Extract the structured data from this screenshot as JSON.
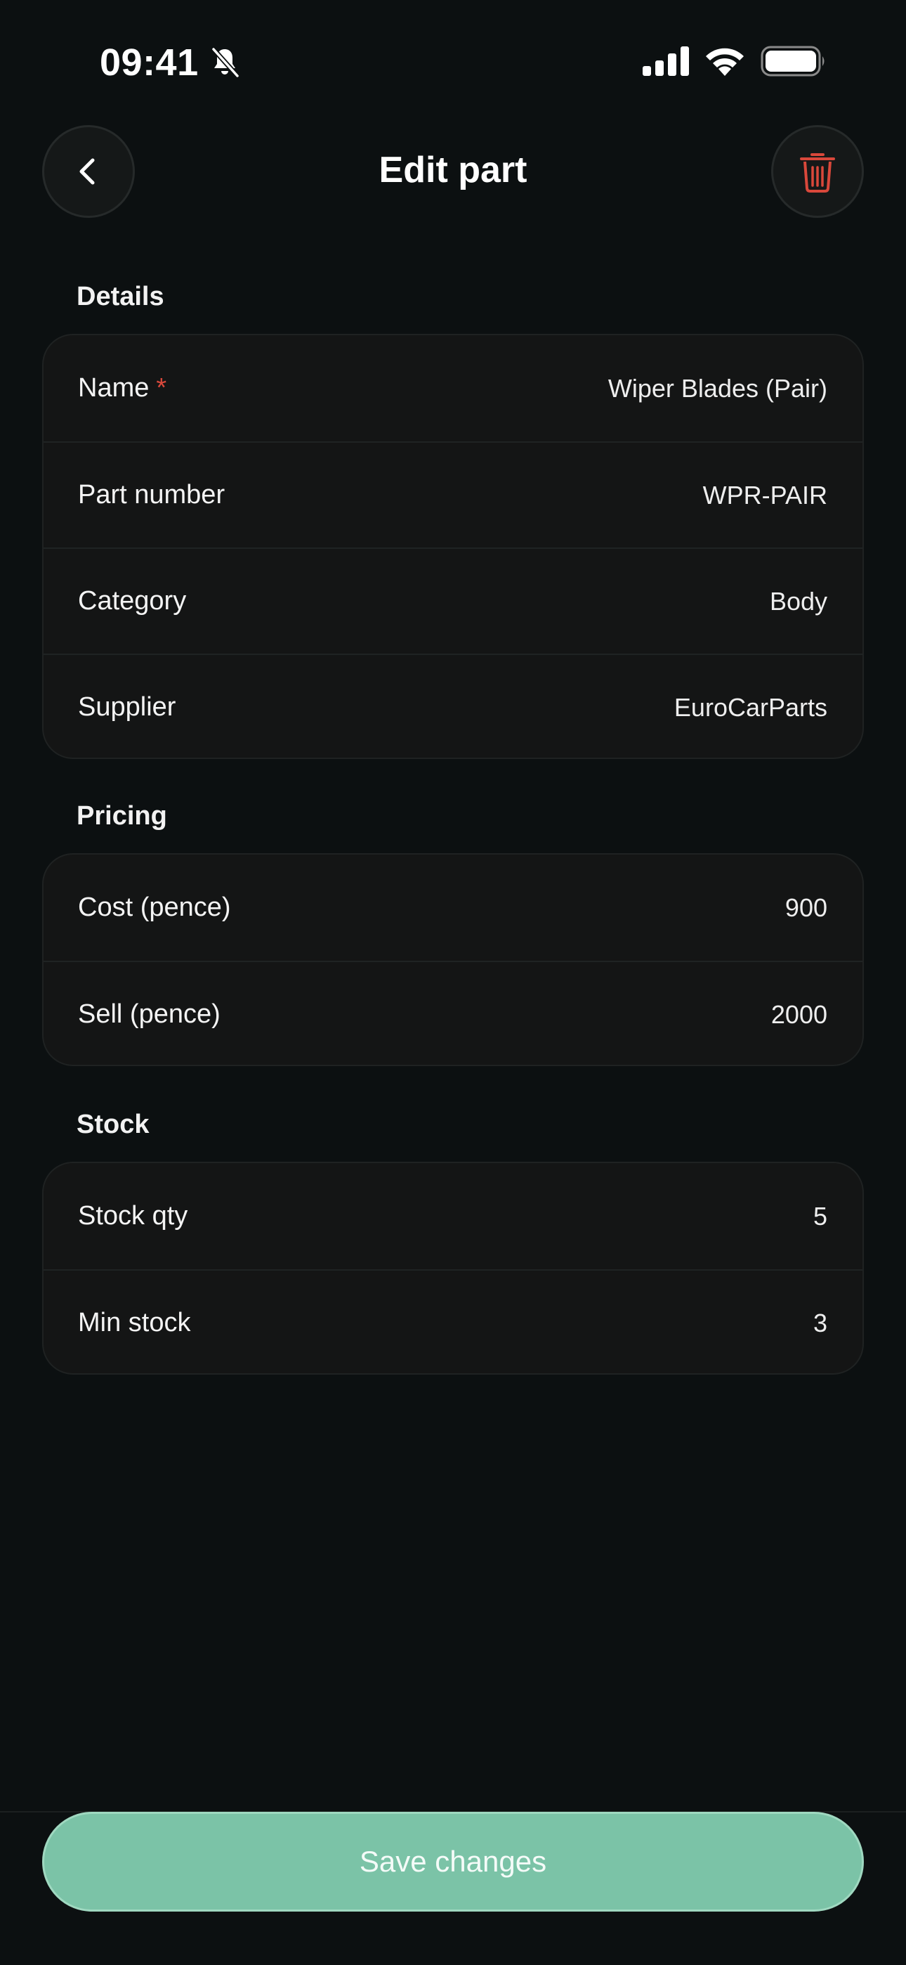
{
  "status_bar": {
    "time": "09:41",
    "icons": [
      "bell-slash-icon",
      "cellular-signal-icon",
      "wifi-icon",
      "battery-icon"
    ]
  },
  "header": {
    "title": "Edit part",
    "back_icon": "chevron-left-icon",
    "delete_icon": "trash-icon"
  },
  "sections": {
    "details": {
      "label": "Details",
      "name": {
        "label": "Name",
        "required_mark": "*",
        "value": "Wiper Blades (Pair)"
      },
      "part_number": {
        "label": "Part number",
        "value": "WPR-PAIR"
      },
      "category": {
        "label": "Category",
        "value": "Body"
      },
      "supplier": {
        "label": "Supplier",
        "value": "EuroCarParts"
      }
    },
    "pricing": {
      "label": "Pricing",
      "cost": {
        "label": "Cost (pence)",
        "value": "900"
      },
      "sell": {
        "label": "Sell (pence)",
        "value": "2000"
      }
    },
    "stock": {
      "label": "Stock",
      "stock_qty": {
        "label": "Stock qty",
        "value": "5"
      },
      "min_stock": {
        "label": "Min stock",
        "value": "3"
      }
    }
  },
  "footer": {
    "save_label": "Save changes"
  },
  "colors": {
    "background": "#0c1011",
    "card": "#141515",
    "accent": "#7bc3a7",
    "danger": "#d9483b"
  }
}
